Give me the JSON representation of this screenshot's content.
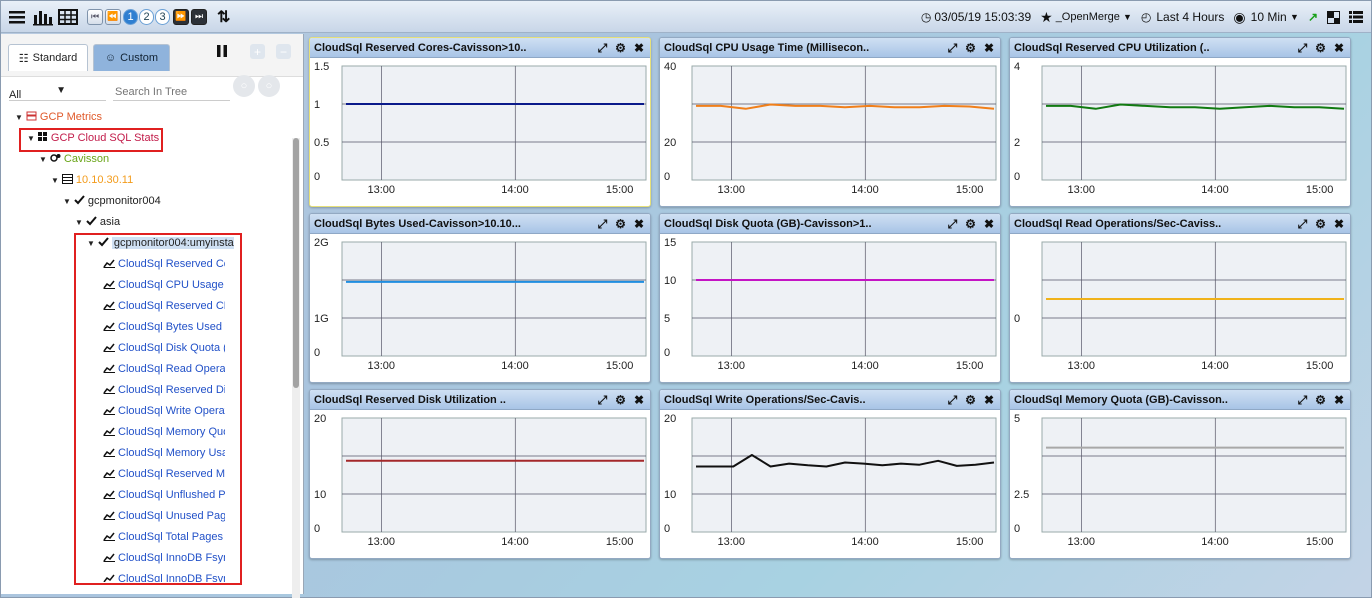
{
  "toolbar": {
    "pages": [
      "1",
      "2",
      "3"
    ],
    "datetime": "03/05/19 15:03:39",
    "favorite": "_OpenMerge",
    "range": "Last 4 Hours",
    "interval": "10 Min"
  },
  "left": {
    "tab_standard": "Standard",
    "tab_custom": "Custom",
    "filter_value": "All",
    "search_placeholder": "Search In Tree",
    "tree": [
      {
        "label": "GCP Metrics",
        "color": "#e05a2b",
        "icon": "db-icon",
        "indent": 14,
        "y": 0
      },
      {
        "label": "GCP Cloud SQL Stats",
        "color": "#c21c4a",
        "icon": "grid-icon",
        "indent": 26,
        "y": 21
      },
      {
        "label": "Cavisson",
        "color": "#6aa519",
        "icon": "gears-icon",
        "indent": 38,
        "y": 42
      },
      {
        "label": "10.10.30.11",
        "color": "#f39b1a",
        "icon": "server-icon",
        "indent": 50,
        "y": 63
      },
      {
        "label": "gcpmonitor004",
        "color": "#222",
        "icon": "check-icon",
        "indent": 62,
        "y": 84
      },
      {
        "label": "asia",
        "color": "#222",
        "icon": "check-icon",
        "indent": 74,
        "y": 105
      },
      {
        "label": "gcpmonitor004:umyinsta",
        "color": "#222",
        "icon": "check-icon",
        "indent": 86,
        "y": 126,
        "selected": true
      }
    ],
    "leaves": [
      "CloudSql Reserved Co",
      "CloudSql CPU Usage T",
      "CloudSql Reserved CP",
      "CloudSql Bytes Used",
      "CloudSql Disk Quota (",
      "CloudSql Read Operat",
      "CloudSql Reserved Di",
      "CloudSql Write Operat",
      "CloudSql Memory Quo",
      "CloudSql Memory Usa",
      "CloudSql Reserved Me",
      "CloudSql Unflushed P",
      "CloudSql Unused Pag",
      "CloudSql Total Pages",
      "CloudSql InnoDB Fsyn",
      "CloudSql InnoDB Fsyn"
    ]
  },
  "panels": [
    {
      "title": "CloudSql Reserved Cores-Cavisson>10..",
      "yticks": [
        "1.5",
        "1",
        "0.5",
        "0"
      ],
      "ymax": 1.5,
      "color": "#0a1a8a",
      "values": [
        1,
        1,
        1,
        1,
        1,
        1,
        1,
        1,
        1,
        1,
        1,
        1,
        1
      ]
    },
    {
      "title": "CloudSql CPU Usage Time (Millisecon..",
      "yticks": [
        "40",
        "",
        "20",
        "0"
      ],
      "ymax": 40,
      "color": "#f07f1a",
      "values": [
        26,
        26,
        25,
        26.5,
        26,
        26,
        25.5,
        26,
        25.5,
        25.5,
        26,
        25.8,
        25
      ]
    },
    {
      "title": "CloudSql Reserved CPU Utilization (..",
      "yticks": [
        "4",
        "",
        "2",
        "0"
      ],
      "ymax": 4,
      "color": "#117a11",
      "values": [
        2.6,
        2.6,
        2.5,
        2.65,
        2.6,
        2.55,
        2.55,
        2.5,
        2.55,
        2.6,
        2.55,
        2.55,
        2.5
      ]
    },
    {
      "title": "CloudSql Bytes Used-Cavisson>10.10...",
      "yticks": [
        "2G",
        "",
        "1G",
        "0"
      ],
      "ymax": 2,
      "color": "#1f8ee0",
      "values": [
        1.3,
        1.3,
        1.3,
        1.3,
        1.3,
        1.3,
        1.3,
        1.3,
        1.3,
        1.3,
        1.3,
        1.3,
        1.3
      ]
    },
    {
      "title": "CloudSql Disk Quota (GB)-Cavisson>1..",
      "yticks": [
        "15",
        "10",
        "5",
        "0"
      ],
      "ymax": 15,
      "color": "#c414c4",
      "values": [
        10,
        10,
        10,
        10,
        10,
        10,
        10,
        10,
        10,
        10,
        10,
        10,
        10
      ]
    },
    {
      "title": "CloudSql Read Operations/Sec-Caviss..",
      "yticks": [
        "",
        "",
        "0",
        ""
      ],
      "ymax": 2,
      "color": "#f0b21a",
      "values": [
        1,
        1,
        1,
        1,
        1,
        1,
        1,
        1,
        1,
        1,
        1,
        1,
        1
      ]
    },
    {
      "title": "CloudSql Reserved Disk Utilization ..",
      "yticks": [
        "20",
        "",
        "10",
        "0"
      ],
      "ymax": 20,
      "color": "#a4282a",
      "values": [
        12.5,
        12.5,
        12.5,
        12.5,
        12.5,
        12.5,
        12.5,
        12.5,
        12.5,
        12.5,
        12.5,
        12.5,
        12.5
      ]
    },
    {
      "title": "CloudSql Write Operations/Sec-Cavis..",
      "yticks": [
        "20",
        "",
        "10",
        "0"
      ],
      "ymax": 20,
      "color": "#111",
      "values": [
        11.5,
        11.5,
        11.5,
        13.5,
        11.5,
        12,
        11.7,
        11.5,
        12.2,
        12,
        11.7,
        12,
        11.8,
        12.5,
        11.6,
        11.8,
        12.2
      ]
    },
    {
      "title": "CloudSql Memory Quota (GB)-Cavisson..",
      "yticks": [
        "5",
        "",
        "2.5",
        "0"
      ],
      "ymax": 5,
      "color": "#a8a8a8",
      "values": [
        3.7,
        3.7,
        3.7,
        3.7,
        3.7,
        3.7,
        3.7,
        3.7,
        3.7,
        3.7,
        3.7,
        3.7,
        3.7
      ]
    }
  ],
  "xticks": [
    "13:00",
    "14:00",
    "15:00"
  ]
}
